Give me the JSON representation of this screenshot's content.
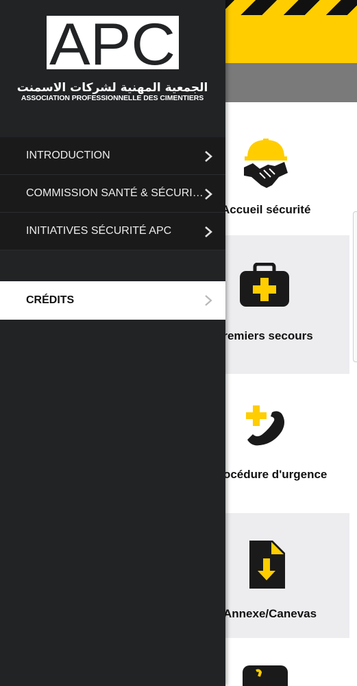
{
  "drawer": {
    "logo": {
      "letters": "APC",
      "arabic_name": "الجمعية المهنية لشركات الاسمنت",
      "french_name": "ASSOCIATION PROFESSIONNELLE DES CIMENTIERS"
    },
    "menu_items": [
      {
        "label": "INTRODUCTION"
      },
      {
        "label": "COMMISSION SANTÉ & SÉCURI…"
      },
      {
        "label": "INITIATIVES SÉCURITÉ APC"
      },
      {
        "label": "CRÉDITS",
        "active": true
      }
    ]
  },
  "main": {
    "tiles": [
      {
        "label": "Accueil sécurité",
        "icon": "handshake-helmet-icon"
      },
      {
        "label": "Premiers secours",
        "icon": "first-aid-kit-icon"
      },
      {
        "label": "Procédure d'urgence",
        "icon": "emergency-phone-icon"
      },
      {
        "label": "Annexe/Canevas",
        "icon": "document-download-icon"
      }
    ]
  },
  "colors": {
    "accent_yellow": "#ffcd00",
    "drawer_bg": "#212325",
    "toolbar_gray": "#7a7a7a"
  }
}
